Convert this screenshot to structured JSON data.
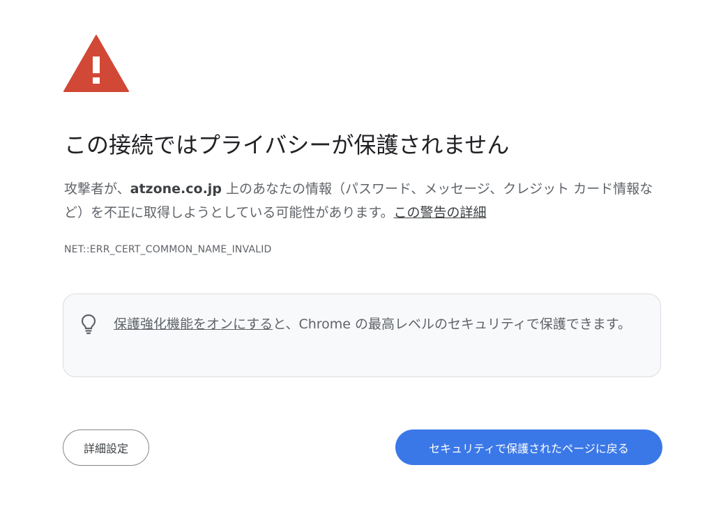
{
  "colors": {
    "warning": "#d14836",
    "primary_button": "#3b78e7",
    "text_primary": "#202124",
    "text_secondary": "#5f6368",
    "box_background": "#f8f9fa"
  },
  "icons": {
    "warning": "warning-triangle-icon",
    "bulb": "lightbulb-icon"
  },
  "heading": "この接続ではプライバシーが保護されません",
  "explanation": {
    "prefix": "攻撃者が、",
    "domain": "atzone.co.jp",
    "body": " 上のあなたの情報（パスワード、メッセージ、クレジット カード情報など）を不正に取得しようとしている可能性があります。",
    "details_link": "この警告の詳細"
  },
  "error_code": "NET::ERR_CERT_COMMON_NAME_INVALID",
  "enhanced_protection": {
    "link": "保護強化機能をオンにする",
    "text": "と、Chrome の最高レベルのセキュリティで保護できます。"
  },
  "buttons": {
    "advanced": "詳細設定",
    "back_to_safety": "セキュリティで保護されたページに戻る"
  }
}
